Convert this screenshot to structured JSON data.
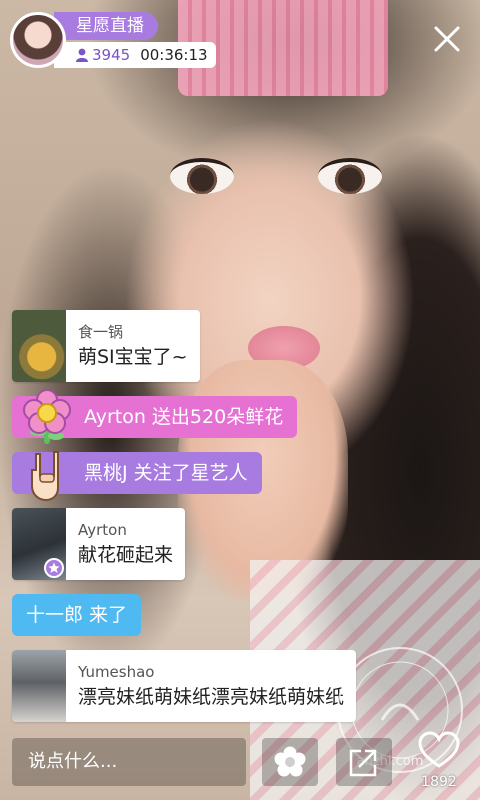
{
  "anchor": {
    "name": "星愿直播",
    "viewers": "3945",
    "timer": "00:36:13"
  },
  "chat": [
    {
      "type": "user",
      "name": "食一锅",
      "message": "萌SI宝宝了~"
    },
    {
      "type": "gift",
      "user": "Ayrton",
      "action": " 送出520朵鲜花"
    },
    {
      "type": "follow",
      "user": "黑桃J",
      "action": " 关注了星艺人"
    },
    {
      "type": "user",
      "name": "Ayrton",
      "message": "献花砸起来"
    },
    {
      "type": "join",
      "text": "十一郎 来了"
    },
    {
      "type": "user",
      "name": "Yumeshao",
      "message": "漂亮妹纸萌妹纸漂亮妹纸萌妹纸"
    }
  ],
  "input": {
    "placeholder": "说点什么..."
  },
  "likes": {
    "count": "1892"
  },
  "watermark": {
    "text": "anzhi.com"
  },
  "colors": {
    "purple": "#a77be0",
    "pink": "#e571d3",
    "blue": "#4fb9f2"
  }
}
